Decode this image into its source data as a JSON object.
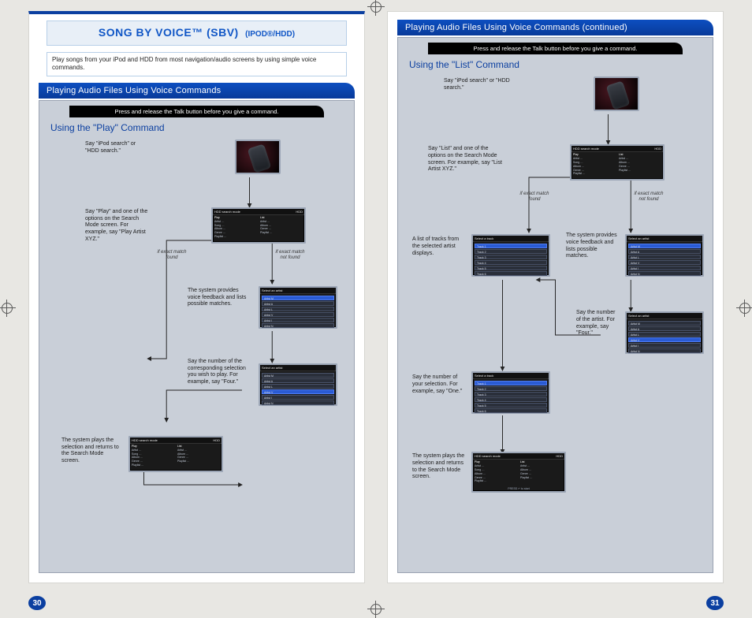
{
  "title": {
    "main": "SONG BY VOICE™ (SBV)",
    "paren": "(IPOD®/HDD)"
  },
  "intro": "Play songs from your iPod and HDD from most navigation/audio screens by using simple voice commands.",
  "left": {
    "section_header": "Playing Audio Files Using Voice Commands",
    "instr": "Press and release the Talk button before you give a command.",
    "subhead": "Using the \"Play\" Command",
    "steps": {
      "say_search": "Say \"iPod search\" or \"HDD search.\"",
      "say_play": "Say \"Play\" and one of the options on the Search Mode screen. For example, say \"Play Artist XYZ.\"",
      "match_found": "if exact match found",
      "match_not_found": "if exact match not found",
      "feedback": "The system provides voice feedback and lists possible matches.",
      "say_number": "Say the number of the corresponding selection you wish to play. For example, say \"Four.\"",
      "plays": "The system plays the selection and returns to the Search Mode screen."
    }
  },
  "right": {
    "section_header": "Playing Audio Files Using Voice Commands (continued)",
    "instr": "Press and release the Talk button before you give a command.",
    "subhead": "Using the \"List\" Command",
    "steps": {
      "say_search": "Say \"iPod search\" or \"HDD search.\"",
      "say_list": "Say \"List\" and one of the options on the Search Mode screen. For example, say \"List Artist XYZ.\"",
      "match_found": "if exact match found",
      "match_not_found": "if exact match not found",
      "tracks": "A list of tracks from the selected artist displays.",
      "feedback": "The system provides voice feedback and lists possible matches.",
      "say_artist_num": "Say the number of the artist. For example, say \"Four.\"",
      "say_selection": "Say the number of your selection. For example, say \"One.\"",
      "plays": "The system plays the selection and returns to the Search Mode screen."
    }
  },
  "screens": {
    "search_mode_title": "HDD search mode",
    "hdd_badge": "HDD",
    "play_label": "Play",
    "list_label": "List",
    "opts_a": [
      "Artist …",
      "Song …",
      "Album …",
      "Genre …",
      "Playlist …"
    ],
    "opts_b": [
      "Artist …",
      "Album …",
      "Genre …",
      "Playlist …"
    ],
    "select_artist": "Select an artist",
    "artists": [
      "Artist M",
      "Artist A",
      "Artist L",
      "Artist V",
      "Artist I",
      "Artist N"
    ],
    "select_track": "Select a track",
    "tracks": [
      "Track 1",
      "Track 2",
      "Track 3",
      "Track 4",
      "Track 5",
      "Track 6"
    ],
    "footer_hint": "PRESS ↵ to start"
  },
  "page_numbers": {
    "left": "30",
    "right": "31"
  }
}
